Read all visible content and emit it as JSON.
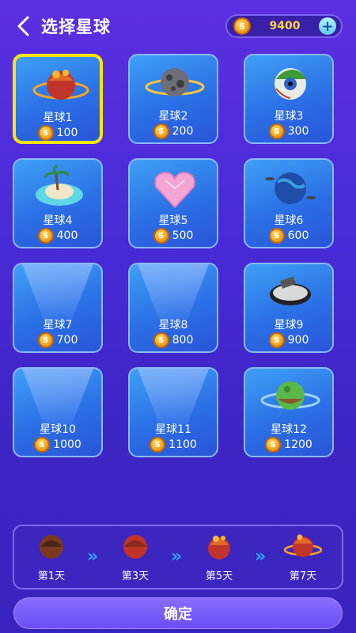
{
  "header": {
    "title": "选择星球",
    "coin_balance": "9400",
    "back_icon": "chevron-left-icon",
    "add_icon": "plus-icon"
  },
  "planets": [
    {
      "name": "星球1",
      "price": "100",
      "selected": true
    },
    {
      "name": "星球2",
      "price": "200"
    },
    {
      "name": "星球3",
      "price": "300"
    },
    {
      "name": "星球4",
      "price": "400"
    },
    {
      "name": "星球5",
      "price": "500"
    },
    {
      "name": "星球6",
      "price": "600"
    },
    {
      "name": "星球7",
      "price": "700"
    },
    {
      "name": "星球8",
      "price": "800"
    },
    {
      "name": "星球9",
      "price": "900"
    },
    {
      "name": "星球10",
      "price": "1000"
    },
    {
      "name": "星球11",
      "price": "1100"
    },
    {
      "name": "星球12",
      "price": "1200"
    }
  ],
  "progression": {
    "days": [
      {
        "label": "第1天"
      },
      {
        "label": "第3天"
      },
      {
        "label": "第5天"
      },
      {
        "label": "第7天"
      }
    ],
    "arrow": "»"
  },
  "confirm_label": "确定",
  "colors": {
    "background": "#4a2bd8",
    "card": "#2b6fe6",
    "selected_border": "#ffe600",
    "coin_text": "#ffd23f",
    "arrow": "#2fa7ff"
  }
}
